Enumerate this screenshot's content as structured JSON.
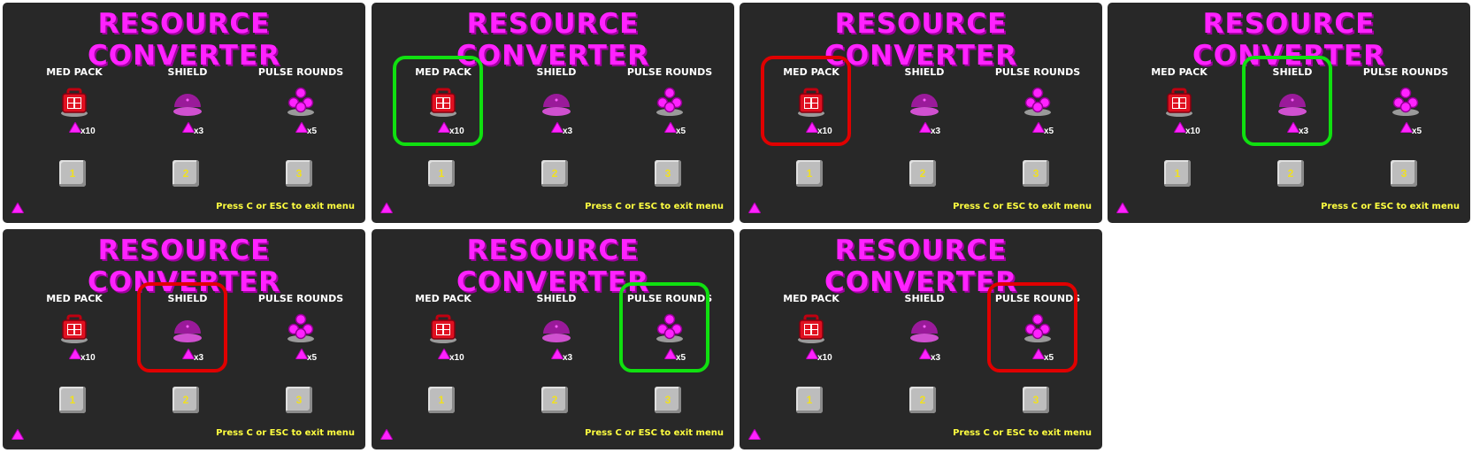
{
  "title": "RESOURCE CONVERTER",
  "exit_hint": "Press C or ESC to exit menu",
  "colors": {
    "panel": "#282828",
    "accent": "#ff22ff",
    "hint": "#ffff40",
    "select_green": "#10e010",
    "select_red": "#e00000",
    "key_text": "#f0e020"
  },
  "items": [
    {
      "label": "MED PACK",
      "cost": "x10",
      "key": "1",
      "icon": "med-pack-icon"
    },
    {
      "label": "SHIELD",
      "cost": "x3",
      "key": "2",
      "icon": "shield-icon"
    },
    {
      "label": "PULSE ROUNDS",
      "cost": "x5",
      "key": "3",
      "icon": "pulse-rounds-icon"
    }
  ],
  "frames": [
    {
      "highlight": null
    },
    {
      "highlight": {
        "item": 0,
        "color": "green"
      }
    },
    {
      "highlight": {
        "item": 0,
        "color": "red"
      }
    },
    {
      "highlight": {
        "item": 1,
        "color": "green"
      }
    },
    {
      "highlight": {
        "item": 1,
        "color": "red"
      }
    },
    {
      "highlight": {
        "item": 2,
        "color": "green"
      }
    },
    {
      "highlight": {
        "item": 2,
        "color": "red"
      }
    }
  ]
}
